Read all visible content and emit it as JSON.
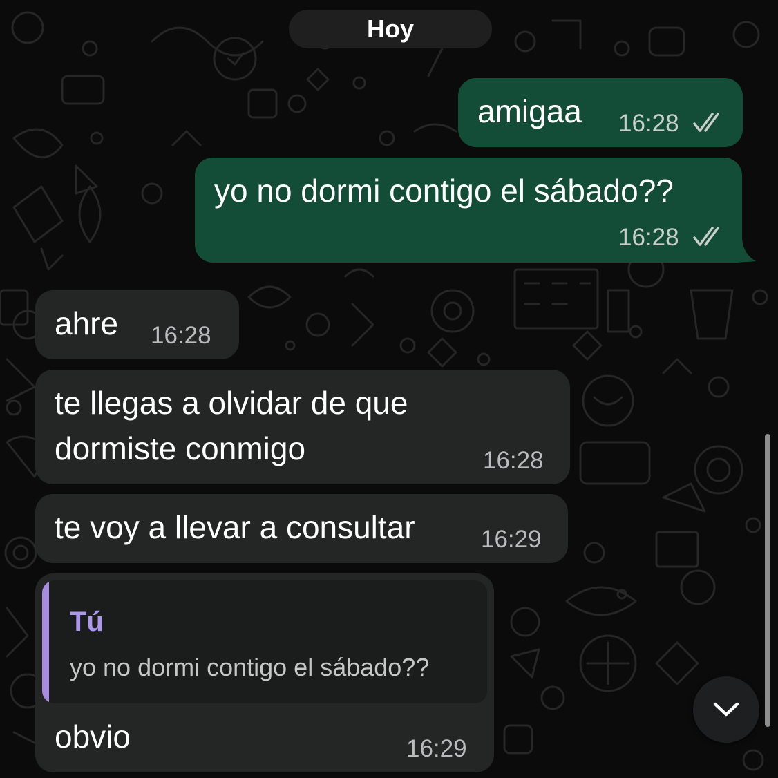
{
  "date_separator": "Hoy",
  "messages": [
    {
      "direction": "outgoing",
      "text": "amigaa",
      "time": "16:28",
      "status": "read-double-check"
    },
    {
      "direction": "outgoing",
      "text": "yo no dormi contigo el sábado??",
      "time": "16:28",
      "status": "read-double-check"
    },
    {
      "direction": "incoming",
      "text": "ahre",
      "time": "16:28"
    },
    {
      "direction": "incoming",
      "lines": [
        "te llegas a olvidar de que",
        "dormiste conmigo"
      ],
      "time": "16:28"
    },
    {
      "direction": "incoming",
      "text": "te voy a llevar a consultar",
      "time": "16:29"
    },
    {
      "direction": "incoming",
      "quote": {
        "author": "Tú",
        "text": "yo no dormi contigo el sábado??"
      },
      "text": "obvio",
      "time": "16:29"
    }
  ],
  "scroll_down_button": {
    "icon": "chevron-down-icon"
  },
  "colors": {
    "background": "#0b0b0b",
    "outgoing_bubble": "#144d37",
    "incoming_bubble": "#242626",
    "quote_accent": "#a78bdf"
  }
}
